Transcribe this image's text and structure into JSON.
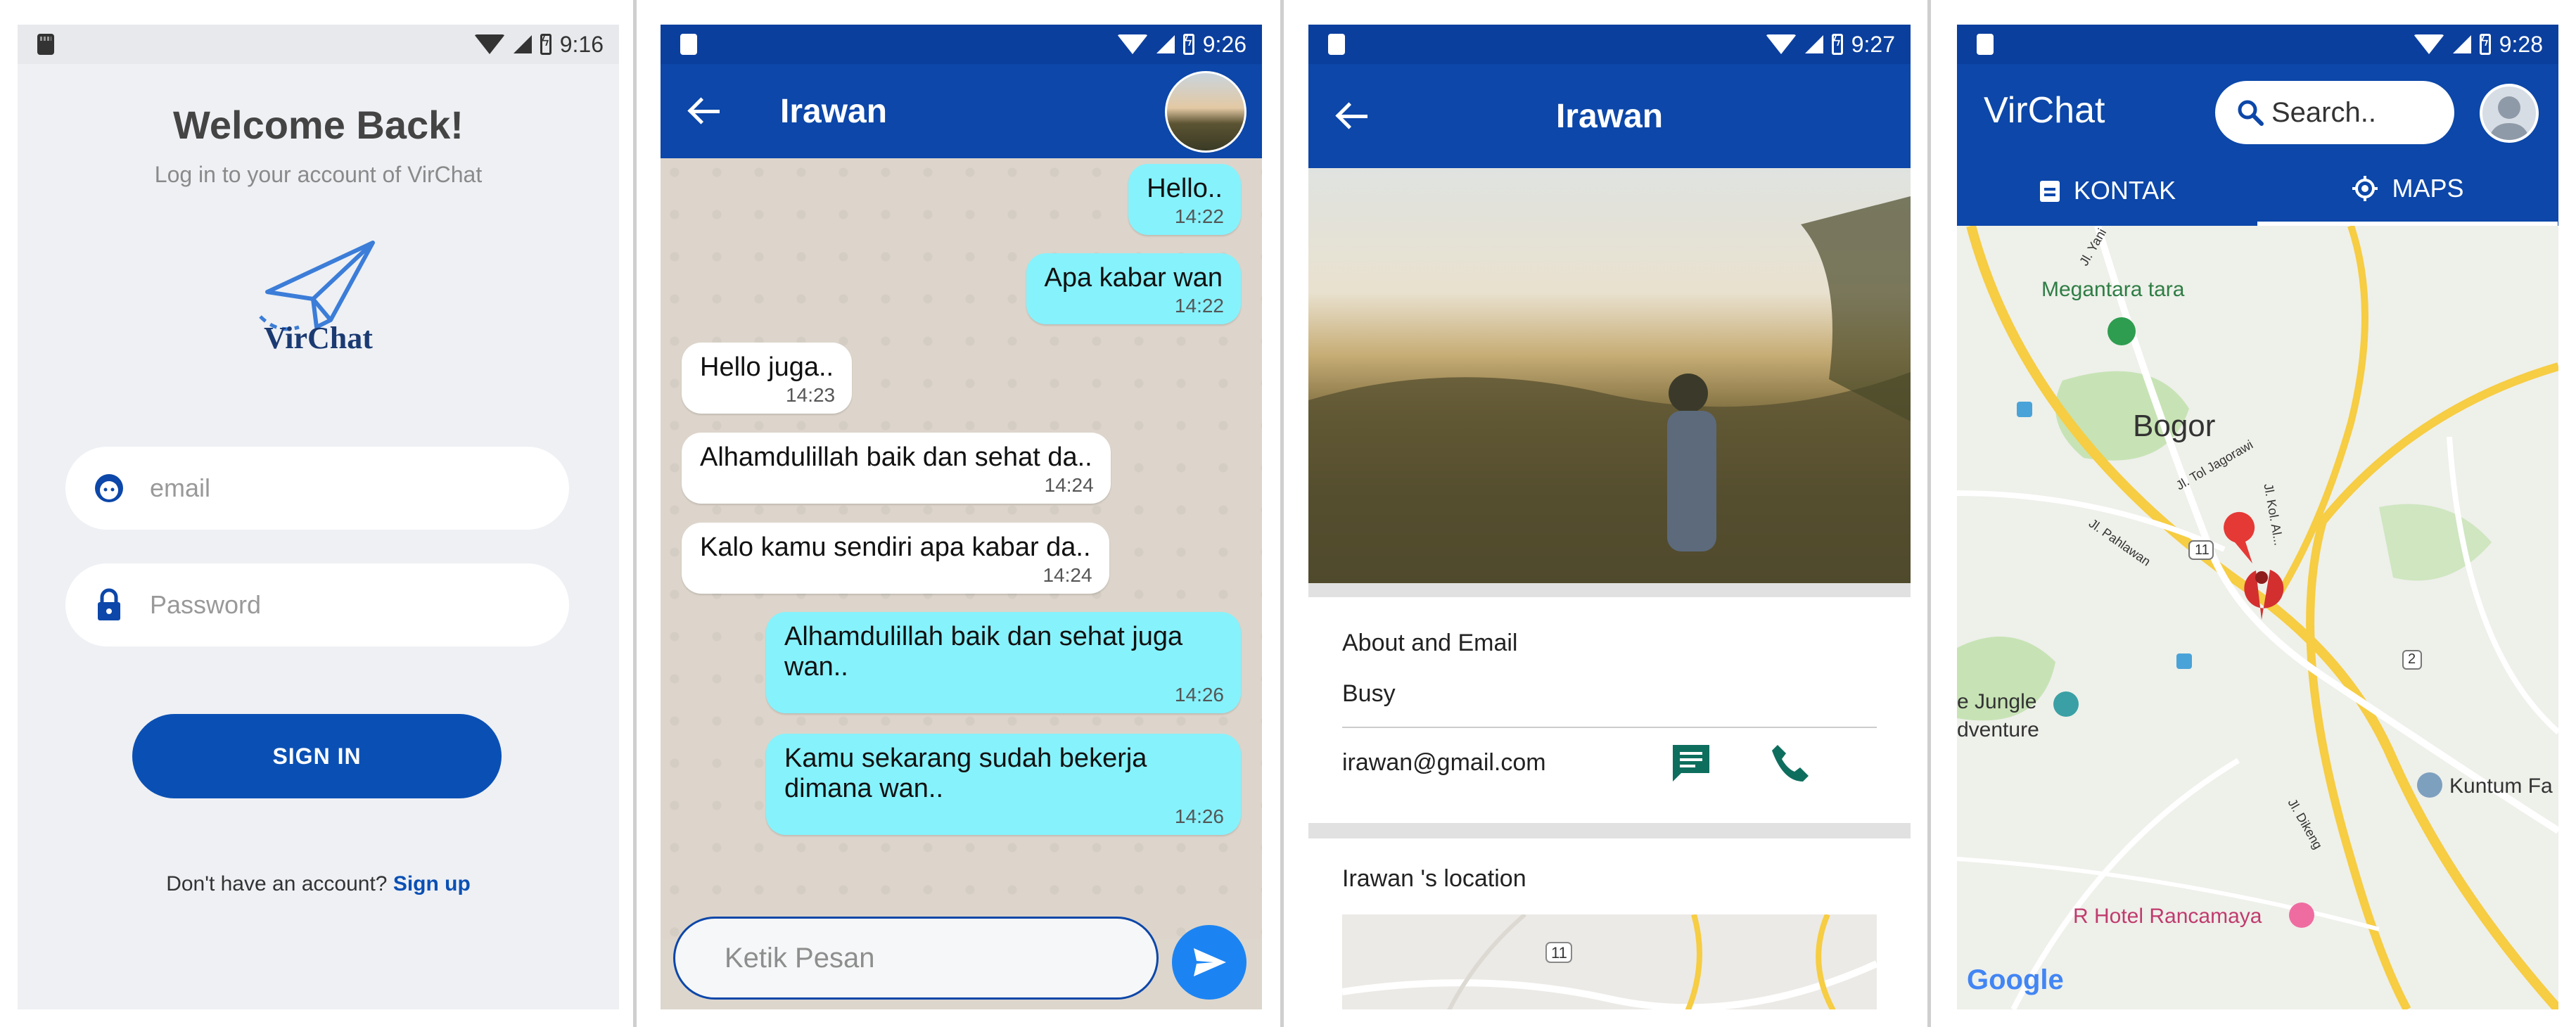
{
  "status": {
    "screen1_time": "9:16",
    "screen2_time": "9:26",
    "screen3_time": "9:27",
    "screen4_time": "9:28"
  },
  "login": {
    "title": "Welcome Back!",
    "subtitle": "Log in to your account of VirChat",
    "logo_text": "VirChat",
    "email_placeholder": "email",
    "password_placeholder": "Password",
    "signin_label": "SIGN IN",
    "no_account_text": "Don't have an account?",
    "signup_link": "Sign up"
  },
  "chat": {
    "contact_name": "Irawan",
    "messages": [
      {
        "text": "Hello..",
        "time": "14:22",
        "dir": "out"
      },
      {
        "text": "Apa kabar wan",
        "time": "14:22",
        "dir": "out"
      },
      {
        "text": "Hello juga..",
        "time": "14:23",
        "dir": "in"
      },
      {
        "text": "Alhamdulillah baik dan sehat da..",
        "time": "14:24",
        "dir": "in"
      },
      {
        "text": "Kalo kamu sendiri apa kabar da..",
        "time": "14:24",
        "dir": "in"
      },
      {
        "text": "Alhamdulillah baik dan sehat juga wan..",
        "time": "14:26",
        "dir": "out"
      },
      {
        "text": "Kamu sekarang sudah bekerja dimana wan..",
        "time": "14:26",
        "dir": "out"
      }
    ],
    "input_placeholder": "Ketik Pesan"
  },
  "profile": {
    "name": "Irawan",
    "about_label": "About and Email",
    "about_value": "Busy",
    "email": "irawan@gmail.com",
    "location_label": "Irawan 's location",
    "mini_map_marker": "11"
  },
  "home": {
    "app_title": "VirChat",
    "search_placeholder": "Search..",
    "tabs": [
      {
        "label": "KONTAK",
        "active": false
      },
      {
        "label": "MAPS",
        "active": true
      }
    ],
    "map": {
      "labels": [
        "Megantara tara",
        "Bogor",
        "Jl. Tol Jagorawi",
        "Jl. Pahlawan",
        "e Jungle",
        "dventure",
        "Kuntum Fa",
        "R Hotel Rancamaya",
        "Jl. Dikeng",
        "Jl. Kol. Al...",
        "Jl. Yani"
      ],
      "road_markers": [
        "11",
        "2"
      ],
      "brand": "Google"
    }
  },
  "colors": {
    "primary": "#0c47a9",
    "accent_bubble": "#86f2fc",
    "send_button": "#1c84f2",
    "signin_button": "#0a50b4"
  }
}
